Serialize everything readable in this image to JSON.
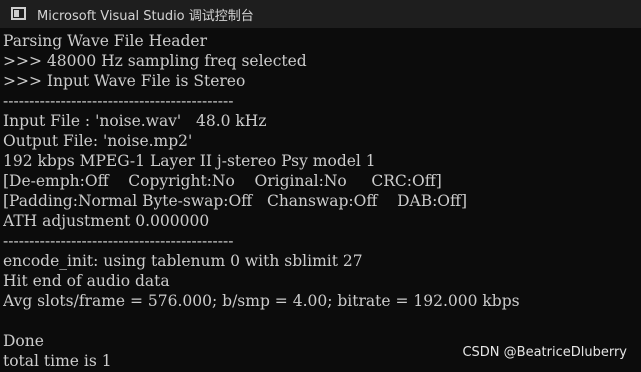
{
  "titlebar": {
    "icon": "console-window-icon",
    "title": "Microsoft Visual Studio 调试控制台"
  },
  "console": {
    "lines": [
      "Parsing Wave File Header",
      ">>> 48000 Hz sampling freq selected",
      ">>> Input Wave File is Stereo",
      "--------------------------------------------",
      "Input File : 'noise.wav'   48.0 kHz",
      "Output File: 'noise.mp2'",
      "192 kbps MPEG-1 Layer II j-stereo Psy model 1",
      "[De-emph:Off    Copyright:No    Original:No     CRC:Off]",
      "[Padding:Normal Byte-swap:Off   Chanswap:Off    DAB:Off]",
      "ATH adjustment 0.000000",
      "--------------------------------------------",
      "encode_init: using tablenum 0 with sblimit 27",
      "Hit end of audio data",
      "Avg slots/frame = 576.000; b/smp = 4.00; bitrate = 192.000 kbps",
      "",
      "Done",
      "total time is 1"
    ]
  },
  "watermark": {
    "text": "CSDN @BeatriceDluberry"
  },
  "colors": {
    "background": "#0c0c0c",
    "titlebar": "#1e1e1e",
    "text": "#cccccc"
  }
}
